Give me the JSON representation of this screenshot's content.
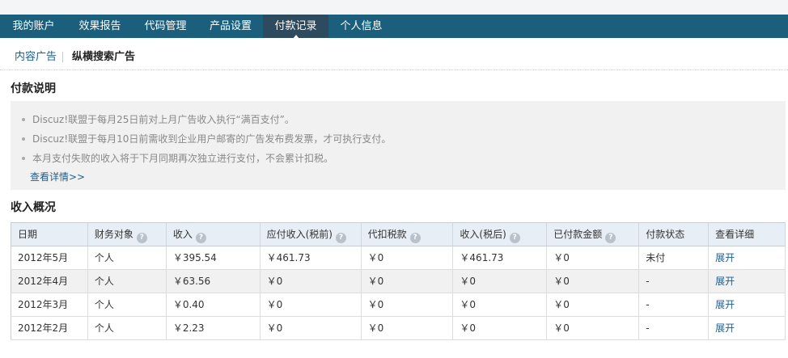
{
  "nav": {
    "items": [
      {
        "label": "我的账户"
      },
      {
        "label": "效果报告"
      },
      {
        "label": "代码管理"
      },
      {
        "label": "产品设置"
      },
      {
        "label": "付款记录"
      },
      {
        "label": "个人信息"
      }
    ],
    "active": "付款记录"
  },
  "subtabs": {
    "first": "内容广告",
    "second": "纵横搜索广告"
  },
  "payment_notes": {
    "title": "付款说明",
    "items": [
      "Discuz!联盟于每月25日前对上月广告收入执行“满百支付”。",
      "Discuz!联盟于每月10日前需收到企业用户邮寄的广告发布费发票，才可执行支付。",
      "本月支付失败的收入将于下月同期再次独立进行支付，不会累计扣税。"
    ],
    "more_link": "查看详情>>"
  },
  "income": {
    "title": "收入概况",
    "help_icon": "?",
    "headers": [
      "日期",
      "财务对象",
      "收入",
      "应付收入(税前)",
      "代扣税款",
      "收入(税后)",
      "已付款金额",
      "付款状态",
      "查看详细"
    ],
    "rows": [
      [
        "2012年5月",
        "个人",
        "￥395.54",
        "￥461.73",
        "￥0",
        "￥461.73",
        "￥0",
        "未付",
        "展开"
      ],
      [
        "2012年4月",
        "个人",
        "￥63.56",
        "￥0",
        "￥0",
        "￥0",
        "￥0",
        "-",
        "展开"
      ],
      [
        "2012年3月",
        "个人",
        "￥0.40",
        "￥0",
        "￥0",
        "￥0",
        "￥0",
        "-",
        "展开"
      ],
      [
        "2012年2月",
        "个人",
        "￥2.23",
        "￥0",
        "￥0",
        "￥0",
        "￥0",
        "-",
        "展开"
      ]
    ]
  }
}
